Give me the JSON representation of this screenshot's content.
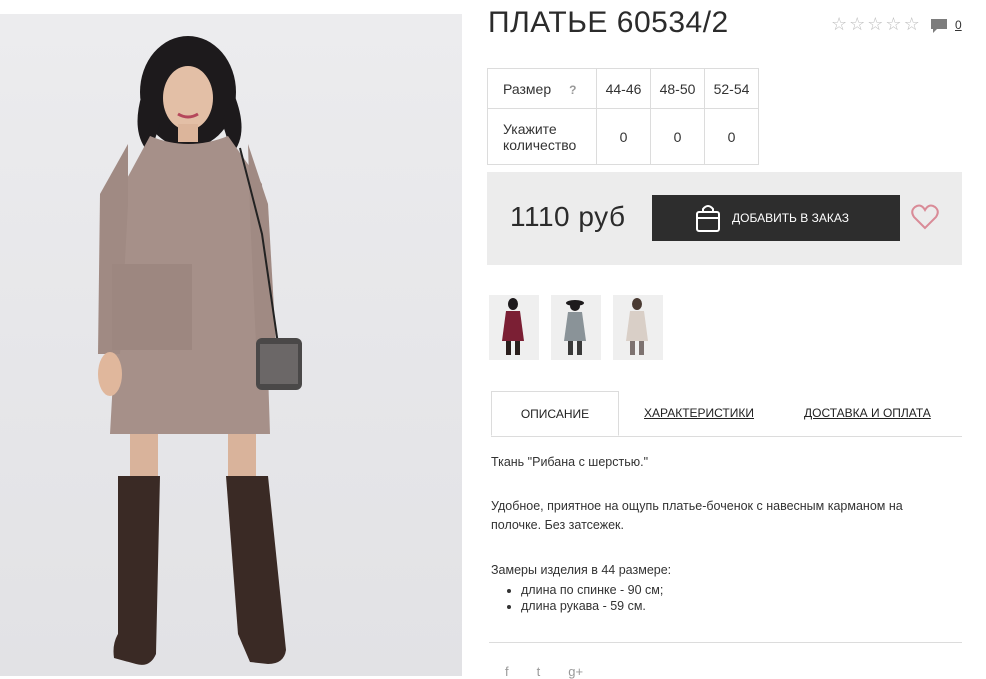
{
  "product": {
    "title": "ПЛАТЬЕ 60534/2",
    "rating_icons": [
      "star-empty",
      "star-empty",
      "star-empty",
      "star-empty",
      "star-empty"
    ],
    "comments_count": "0"
  },
  "sizes": {
    "size_label": "Размер",
    "help": "?",
    "quantity_label": "Укажите количество",
    "columns": [
      "44-46",
      "48-50",
      "52-54"
    ],
    "quantities": [
      "0",
      "0",
      "0"
    ]
  },
  "purchase": {
    "price": "1110 руб",
    "order_button": "ДОБАВИТЬ В ЗАКАЗ"
  },
  "tabs": [
    {
      "label": "ОПИСАНИЕ",
      "active": true
    },
    {
      "label": "ХАРАКТЕРИСТИКИ",
      "active": false
    },
    {
      "label": "ДОСТАВКА И ОПЛАТА",
      "active": false
    }
  ],
  "description": {
    "fabric": "Ткань \"Рибана с шерстью.\"",
    "text": "Удобное, приятное на ощупь платье-боченок с навесным карманом на полочке. Без затсежек.",
    "measurements_title": "Замеры изделия в 44 размере:",
    "measurements": [
      "длина по спинке - 90 см;",
      "длина рукава - 59 см."
    ]
  },
  "social": {
    "icons": [
      "facebook-icon",
      "twitter-icon",
      "google-plus-icon"
    ],
    "labels": [
      "f",
      "t",
      "g+"
    ]
  },
  "colors": {
    "accent_heart": "#d98b97",
    "button_bg": "#2d2d2d",
    "price_box_bg": "#ececec"
  }
}
